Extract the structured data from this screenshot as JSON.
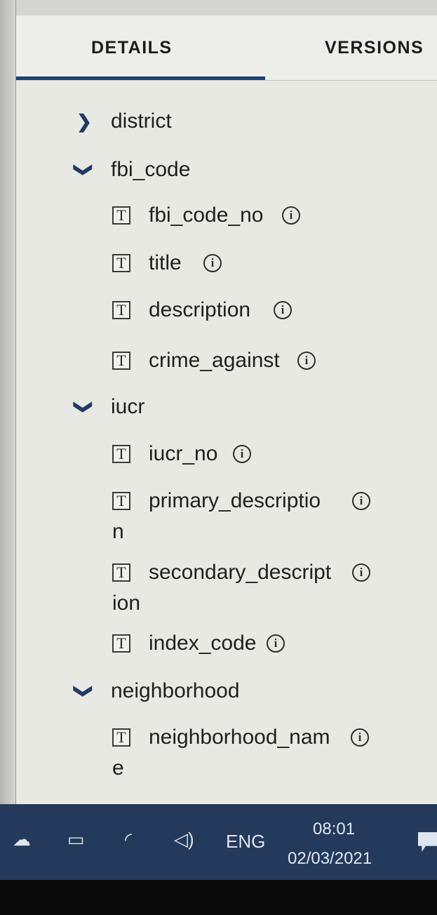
{
  "tabs": {
    "details": "DETAILS",
    "versions": "VERSIONS"
  },
  "tree": {
    "district": {
      "label": "district",
      "expanded": false
    },
    "fbi_code": {
      "label": "fbi_code",
      "expanded": true,
      "fields": [
        "fbi_code_no",
        "title",
        "description",
        "crime_against"
      ]
    },
    "iucr": {
      "label": "iucr",
      "expanded": true,
      "fields": [
        {
          "line1": "iucr_no",
          "line2": ""
        },
        {
          "line1": "primary_descriptio",
          "line2": "n"
        },
        {
          "line1": "secondary_descript",
          "line2": "ion"
        },
        {
          "line1": "index_code",
          "line2": ""
        }
      ]
    },
    "neighborhood": {
      "label": "neighborhood",
      "expanded": true,
      "fields": [
        {
          "line1": "neighborhood_nam",
          "line2": "e"
        }
      ]
    },
    "field_type_glyph": "T",
    "info_glyph": "i",
    "chevron_collapsed": "❯",
    "chevron_expanded": "❯"
  },
  "taskbar": {
    "language": "ENG",
    "time": "08:01",
    "date": "02/03/2021",
    "icons": [
      "cloud-icon",
      "battery-icon",
      "wifi-icon",
      "volume-icon",
      "notification-icon"
    ]
  },
  "colors": {
    "tab_underline": "#1e3f6f",
    "chevron": "#1f3a66",
    "taskbar": "#243a5c"
  }
}
